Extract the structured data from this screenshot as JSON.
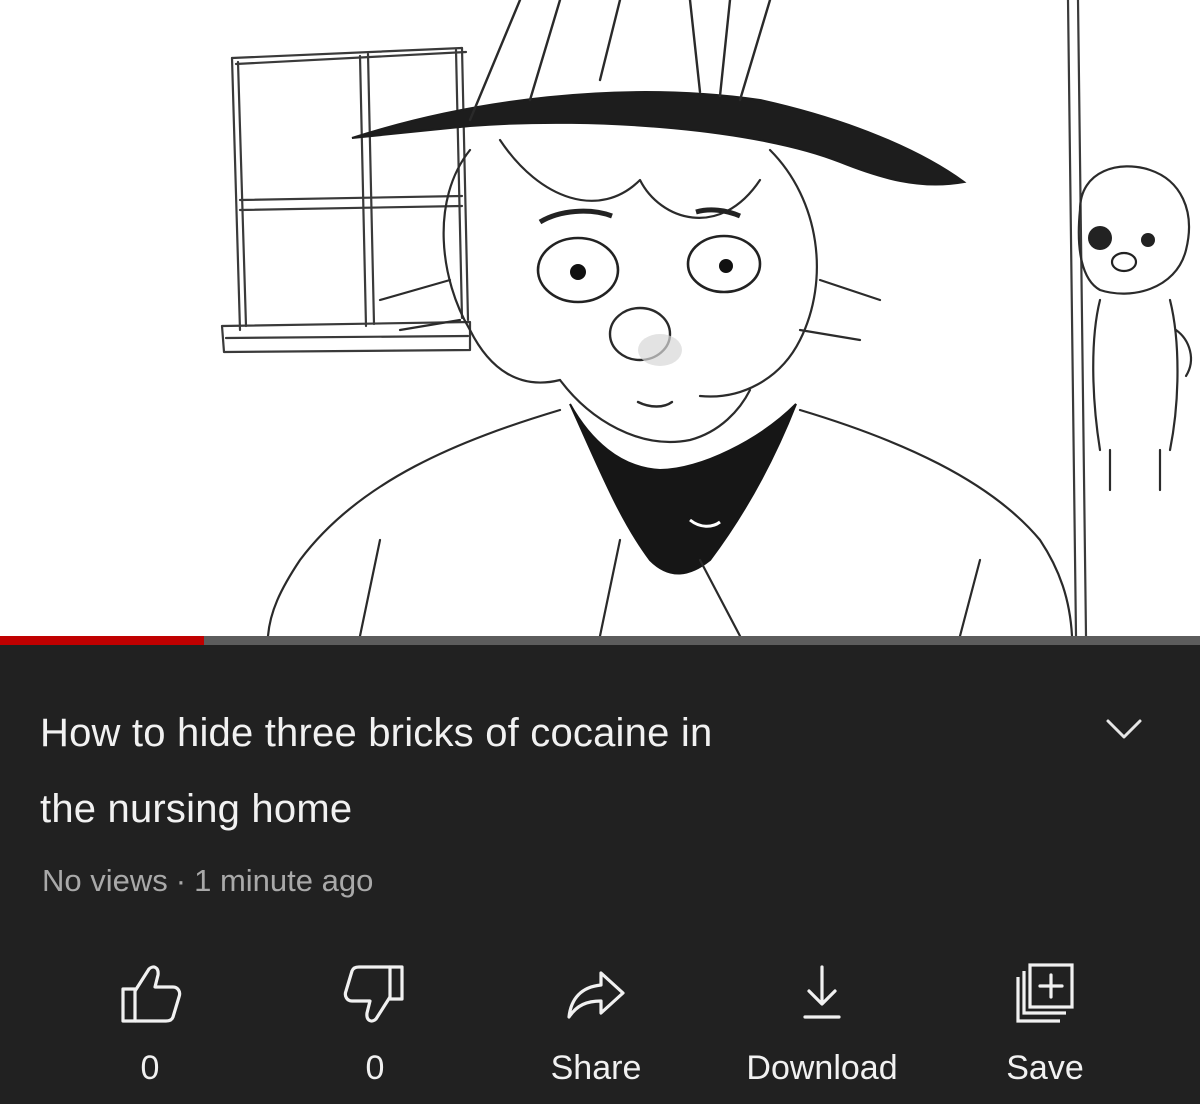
{
  "video": {
    "thumbnail_icon": "sketch-illustration",
    "progress_fraction": 0.17
  },
  "colors": {
    "background": "#212121",
    "text_primary": "#f1f1f1",
    "text_secondary": "#a9a9a9",
    "progress_played": "#c00000",
    "progress_track": "#5c5c5c"
  },
  "title": {
    "line1": "How to hide three bricks of cocaine in",
    "line2": "the nursing home",
    "expand_icon": "chevron-down-icon"
  },
  "meta": {
    "views": "No views",
    "separator": "·",
    "age": "1 minute ago"
  },
  "actions": [
    {
      "id": "like",
      "icon": "thumbs-up-icon",
      "label": "0"
    },
    {
      "id": "dislike",
      "icon": "thumbs-down-icon",
      "label": "0"
    },
    {
      "id": "share",
      "icon": "share-arrow-icon",
      "label": "Share"
    },
    {
      "id": "download",
      "icon": "download-icon",
      "label": "Download"
    },
    {
      "id": "save",
      "icon": "save-playlist-icon",
      "label": "Save"
    }
  ]
}
